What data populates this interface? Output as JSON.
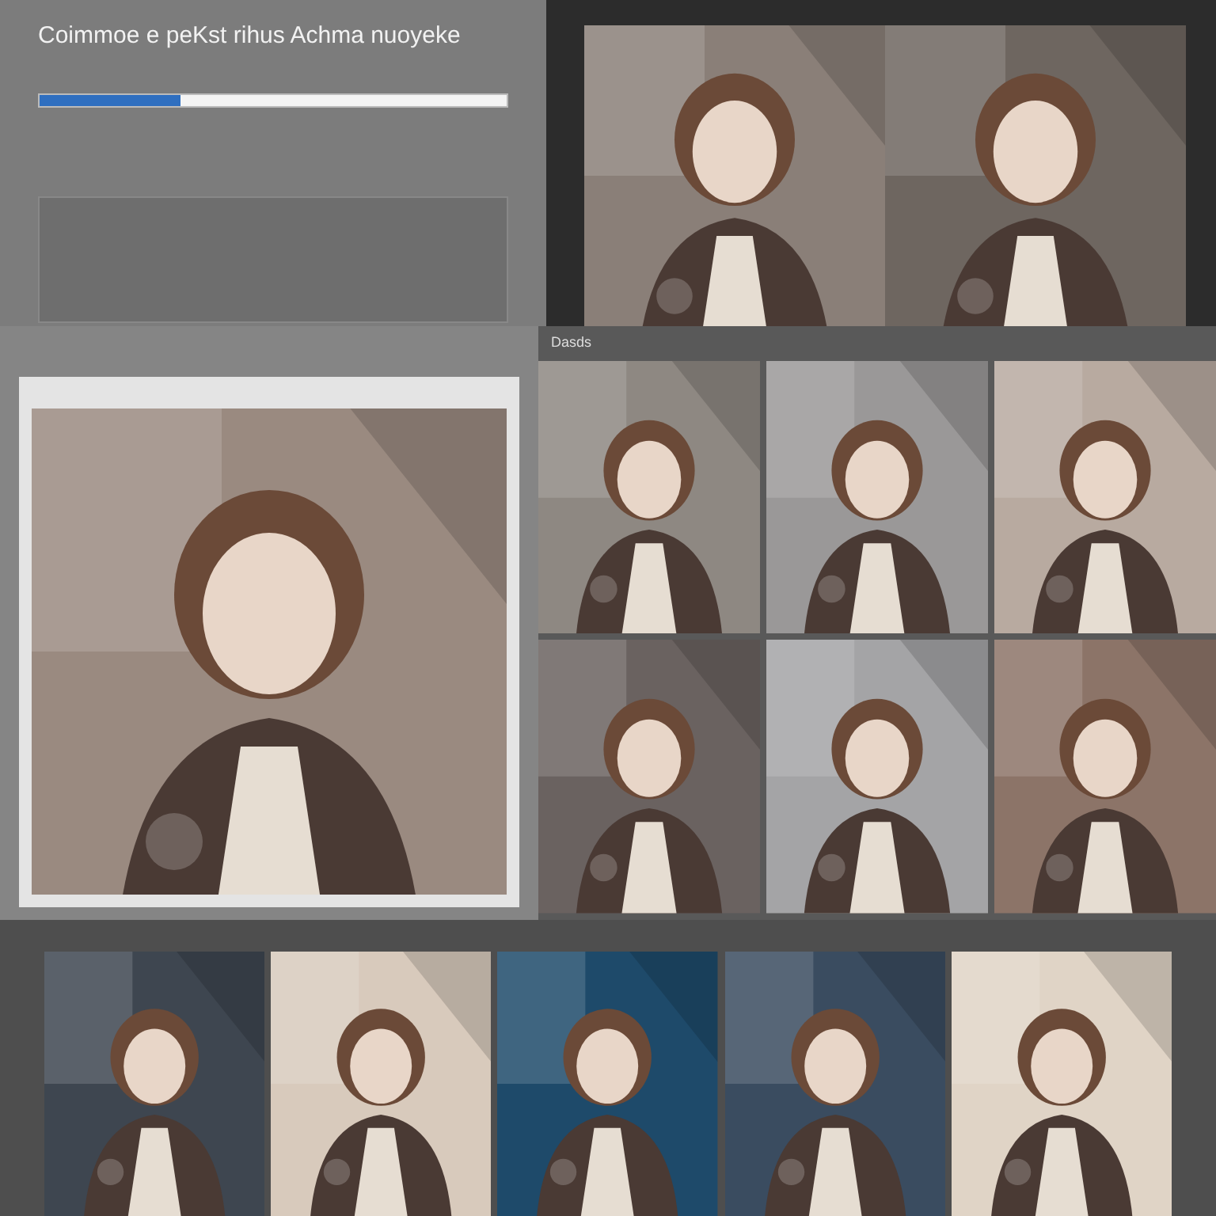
{
  "window": {
    "title": "Coimmoe e peKst rihus Achma nuoyeke"
  },
  "progress": {
    "level": 0.3
  },
  "gallery": {
    "title": "Dasds"
  }
}
